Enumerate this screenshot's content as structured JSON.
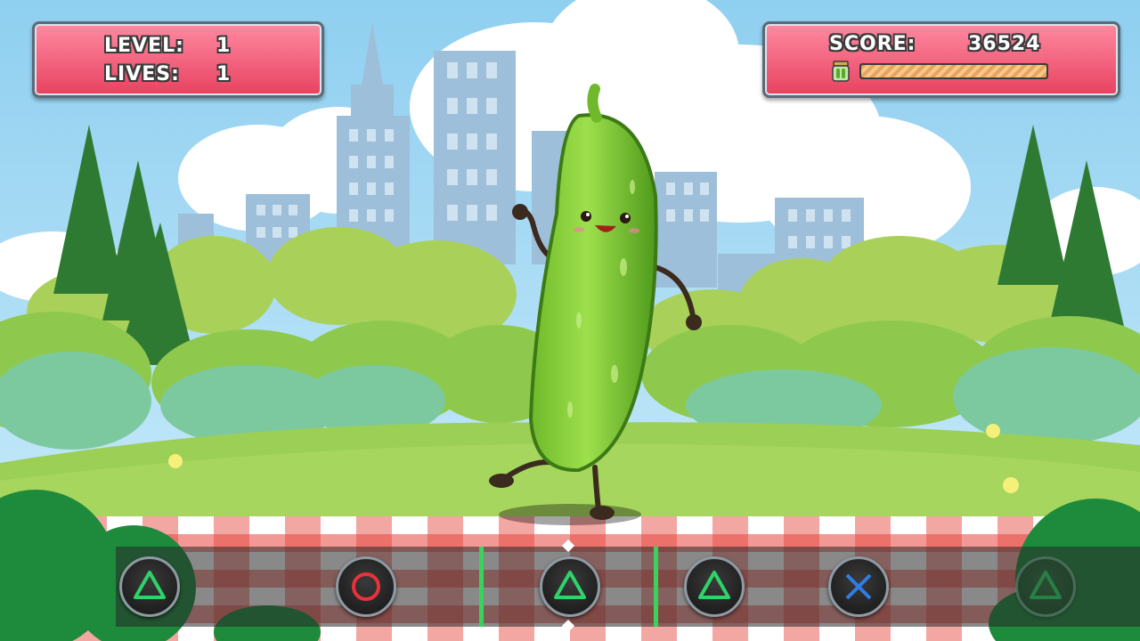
{
  "hud": {
    "level_label": "LEVEL:",
    "level_value": "1",
    "lives_label": "LIVES:",
    "lives_value": "1",
    "score_label": "SCORE:",
    "score_value": "36524",
    "meter_fill": 1.0,
    "meter_icon": "pickle-jar-icon"
  },
  "track": {
    "buttons": [
      {
        "symbol": "triangle",
        "color": "#2ed36a"
      },
      {
        "symbol": "circle",
        "color": "#e8323a"
      },
      {
        "symbol": "triangle",
        "color": "#2ed36a"
      },
      {
        "symbol": "triangle",
        "color": "#2ed36a"
      },
      {
        "symbol": "cross",
        "color": "#2f7de3"
      },
      {
        "symbol": "triangle",
        "color": "#2ed36a"
      }
    ]
  },
  "colors": {
    "hud_panel": "#e8415f",
    "hit_zone": "#39d35b",
    "sky": "#a9d9f2",
    "grass": "#9ccf55"
  }
}
